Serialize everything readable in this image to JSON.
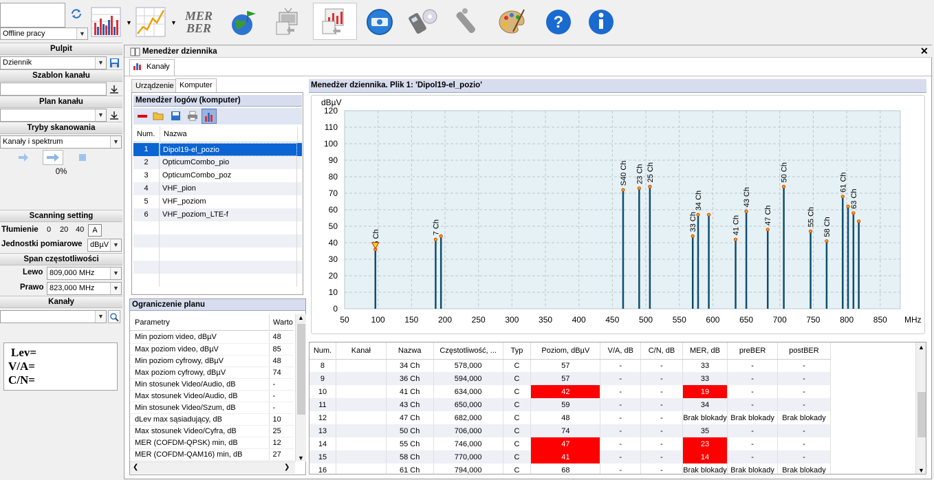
{
  "toolbar": {
    "mode": "Offline pracy",
    "mer_label": "MER",
    "ber_label": "BER"
  },
  "left": {
    "pulpit": "Pulpit",
    "pulpit_value": "Dziennik",
    "szablon": "Szablon kanału",
    "plan": "Plan kanału",
    "tryby": "Tryby skanowania",
    "tryby_value": "Kanały i spektrum",
    "progress": "0%",
    "scanning": "Scanning setting",
    "tlumienie": "Tłumienie",
    "att": [
      "0",
      "20",
      "40"
    ],
    "att_btn": "A",
    "jednostki": "Jednostki pomiarowe",
    "jednostki_value": "dBµV",
    "span": "Span częstotliwości",
    "lewo": "Lewo",
    "lewo_value": "809,000 MHz",
    "prawo": "Prawo",
    "prawo_value": "823,000 MHz",
    "kanaly": "Kanały",
    "lev": "Lev=",
    "va": "V/A=",
    "cn": "C/N="
  },
  "window": {
    "title": "Menedżer dziennika",
    "tab": "Kanały",
    "subtabs": [
      "Urządzenie",
      "Komputer"
    ]
  },
  "logs": {
    "title": "Menedżer logów (komputer)",
    "col_num": "Num.",
    "col_name": "Nazwa",
    "rows": [
      {
        "num": "1",
        "name": "Dipol19-el_pozio"
      },
      {
        "num": "2",
        "name": "OpticumCombo_pio"
      },
      {
        "num": "3",
        "name": "OpticumCombo_poz"
      },
      {
        "num": "4",
        "name": "VHF_pion"
      },
      {
        "num": "5",
        "name": "VHF_poziom"
      },
      {
        "num": "6",
        "name": "VHF_poziom_LTE-f"
      }
    ]
  },
  "plan": {
    "title": "Ograniczenie planu",
    "col_param": "Parametry",
    "col_val": "Warto",
    "rows": [
      [
        "Min poziom video, dBµV",
        "48"
      ],
      [
        "Max poziom video, dBµV",
        "85"
      ],
      [
        "Min poziom cyfrowy, dBµV",
        "48"
      ],
      [
        "Max poziom cyfrowy, dBµV",
        "74"
      ],
      [
        "Min stosunek Video/Audio, dB",
        "-"
      ],
      [
        "Max stosunek Video/Audio, dB",
        "-"
      ],
      [
        "Min stosunek Video/Szum, dB",
        "-"
      ],
      [
        "dLev max sąsiadujący, dB",
        "10"
      ],
      [
        "Max stosunek Video/Cyfra, dB",
        "25"
      ],
      [
        "MER (COFDM-QPSK) min, dB",
        "12"
      ],
      [
        "MER (COFDM-QAM16) min, dB",
        "27"
      ]
    ]
  },
  "chart_title": "Menedżer dziennika.  Plik 1: 'Dipol19-el_pozio'",
  "chart_data": {
    "type": "bar",
    "ylabel": "dBµV",
    "xlabel": "MHz",
    "xlim": [
      50,
      880
    ],
    "ylim": [
      0,
      120
    ],
    "xticks": [
      50,
      100,
      150,
      200,
      250,
      300,
      350,
      400,
      450,
      500,
      550,
      600,
      650,
      700,
      750,
      800,
      850
    ],
    "yticks": [
      0,
      10,
      20,
      30,
      40,
      50,
      60,
      70,
      80,
      90,
      100,
      110,
      120
    ],
    "bars": [
      {
        "x": 96,
        "y": 36,
        "label": "5 Ch"
      },
      {
        "x": 186,
        "y": 42,
        "label": "7 Ch"
      },
      {
        "x": 194,
        "y": 44,
        "label": ""
      },
      {
        "x": 466,
        "y": 72,
        "label": "S40 Ch"
      },
      {
        "x": 490,
        "y": 73,
        "label": "23 Ch"
      },
      {
        "x": 506,
        "y": 74,
        "label": "25 Ch"
      },
      {
        "x": 570,
        "y": 44,
        "label": "33 Ch"
      },
      {
        "x": 578,
        "y": 57,
        "label": "34 Ch"
      },
      {
        "x": 594,
        "y": 57,
        "label": ""
      },
      {
        "x": 634,
        "y": 42,
        "label": "41 Ch"
      },
      {
        "x": 650,
        "y": 59,
        "label": "43 Ch"
      },
      {
        "x": 682,
        "y": 48,
        "label": "47 Ch"
      },
      {
        "x": 706,
        "y": 74,
        "label": "50 Ch"
      },
      {
        "x": 746,
        "y": 47,
        "label": "55 Ch"
      },
      {
        "x": 770,
        "y": 41,
        "label": "58 Ch"
      },
      {
        "x": 794,
        "y": 68,
        "label": "61 Ch"
      },
      {
        "x": 802,
        "y": 62,
        "label": ""
      },
      {
        "x": 810,
        "y": 58,
        "label": "63 Ch"
      },
      {
        "x": 818,
        "y": 53,
        "label": ""
      }
    ]
  },
  "result": {
    "headers": [
      "Num.",
      "Kanał",
      "Nazwa",
      "Częstotliwość, ...",
      "Typ",
      "Poziom, dBµV",
      "V/A, dB",
      "C/N, dB",
      "MER, dB",
      "preBER",
      "postBER"
    ],
    "rows": [
      [
        "8",
        "",
        "34 Ch",
        "578,000",
        "C",
        "57",
        "-",
        "-",
        "33",
        "-",
        "-"
      ],
      [
        "9",
        "",
        "36 Ch",
        "594,000",
        "C",
        "57",
        "-",
        "-",
        "33",
        "-",
        "-"
      ],
      [
        "10",
        "",
        "41 Ch",
        "634,000",
        "C",
        "42",
        "-",
        "-",
        "19",
        "-",
        "-"
      ],
      [
        "11",
        "",
        "43 Ch",
        "650,000",
        "C",
        "59",
        "-",
        "-",
        "34",
        "-",
        "-"
      ],
      [
        "12",
        "",
        "47 Ch",
        "682,000",
        "C",
        "48",
        "-",
        "-",
        "Brak blokady",
        "Brak blokady",
        "Brak blokady"
      ],
      [
        "13",
        "",
        "50 Ch",
        "706,000",
        "C",
        "74",
        "-",
        "-",
        "35",
        "-",
        "-"
      ],
      [
        "14",
        "",
        "55 Ch",
        "746,000",
        "C",
        "47",
        "-",
        "-",
        "23",
        "-",
        "-"
      ],
      [
        "15",
        "",
        "58 Ch",
        "770,000",
        "C",
        "41",
        "-",
        "-",
        "14",
        "-",
        "-"
      ],
      [
        "16",
        "",
        "61 Ch",
        "794,000",
        "C",
        "68",
        "-",
        "-",
        "Brak blokady",
        "Brak blokady",
        "Brak blokady"
      ]
    ],
    "red": [
      [
        2,
        5
      ],
      [
        2,
        8
      ],
      [
        6,
        5
      ],
      [
        6,
        8
      ],
      [
        7,
        5
      ],
      [
        7,
        8
      ]
    ]
  }
}
